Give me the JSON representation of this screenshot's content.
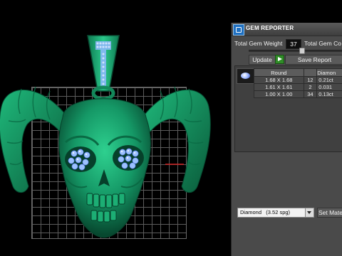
{
  "viewport": {
    "model_description_icon": "skull-pendant-icon",
    "grid_visible": true,
    "colors": {
      "metal": "#1fa574",
      "metal_dark": "#0c5a3c",
      "gem": "#9cc1ff"
    }
  },
  "panel": {
    "title": "GEM REPORTER",
    "total_gem_weight_label": "Total Gem Weight",
    "total_gem_weight_value": "37",
    "total_gem_count_label": "Total Gem Co",
    "update_label": "Update",
    "save_report_label": "Save Report",
    "table": {
      "headers": [
        "Round",
        "",
        "Diamon"
      ],
      "rows": [
        [
          "1.68 X 1.68",
          "12",
          "0.21ct"
        ],
        [
          "1.61 X 1.61",
          "2",
          "0.031"
        ],
        [
          "1.00 X 1.00",
          "34",
          "0.13ct"
        ]
      ]
    },
    "material_select": {
      "value": "Diamond",
      "spg": "(3.52 spg)"
    },
    "set_material_label": "Set Mate"
  }
}
